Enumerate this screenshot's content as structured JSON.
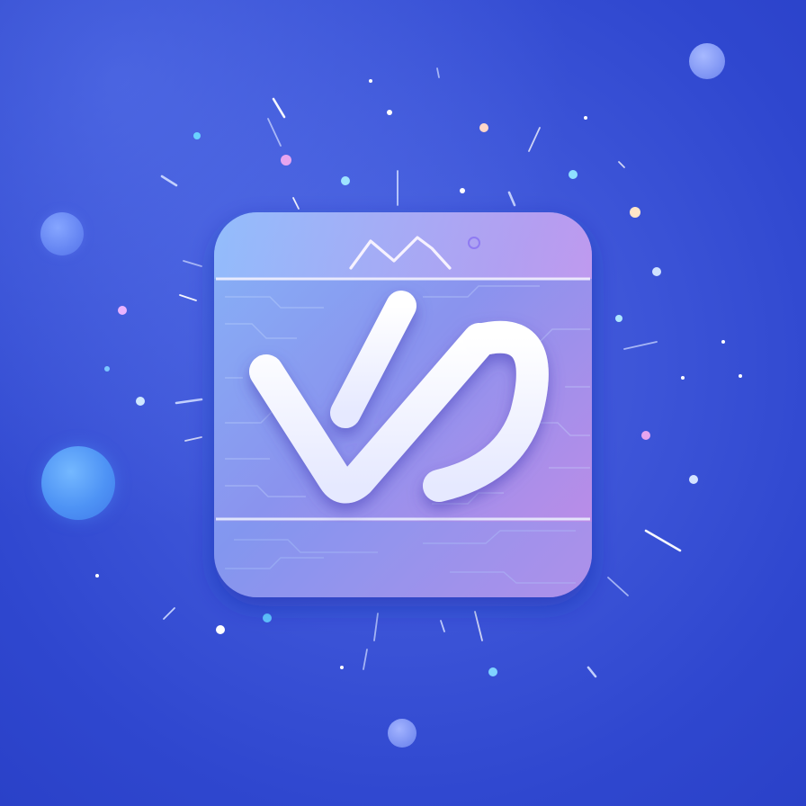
{
  "scene": {
    "description_free": true,
    "colors": {
      "background": "#3550d6",
      "tile_left": "#7fa9f6",
      "tile_right": "#c58ae6",
      "glyph": "#f4f6ff",
      "orb_blue": "#4e93f5",
      "particle_pink": "#e39ae6"
    }
  },
  "icon": {
    "name": "app-icon-tile",
    "glyph_icon": "check-swoosh-glyph",
    "crown_icon": "zigzag-crown-icon"
  }
}
